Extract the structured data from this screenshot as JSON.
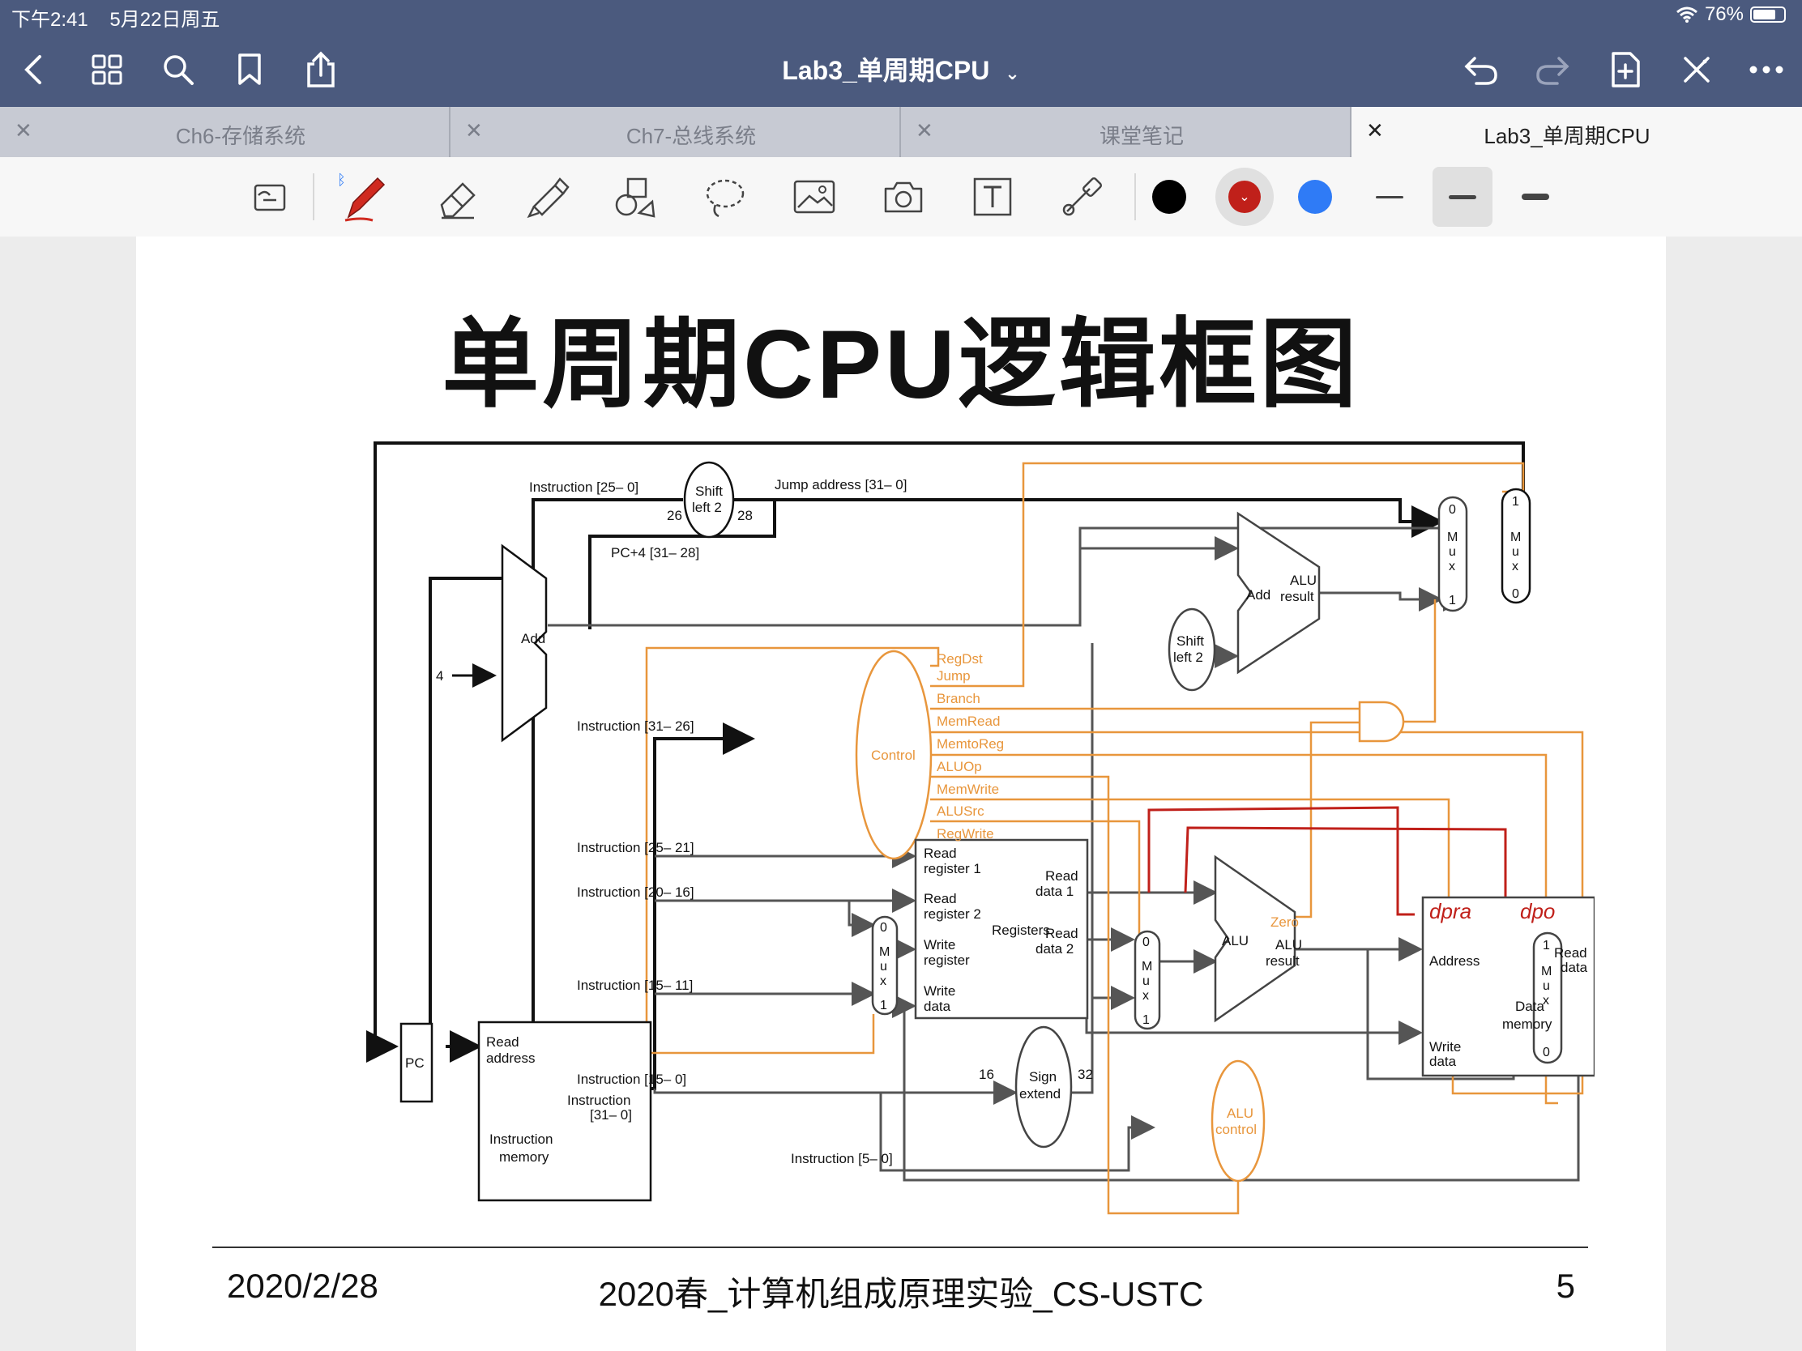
{
  "status": {
    "time": "下午2:41",
    "date": "5月22日周五",
    "battery": "76%",
    "battery_level": 0.76
  },
  "navbar": {
    "title": "Lab3_单周期CPU",
    "icons": [
      "back-icon",
      "grid-icon",
      "search-icon",
      "bookmark-icon",
      "share-icon",
      "undo-icon",
      "redo-icon",
      "add-page-icon",
      "close-tools-icon",
      "more-icon"
    ]
  },
  "tabs": [
    {
      "label": "Ch6-存储系统",
      "active": false
    },
    {
      "label": "Ch7-总线系统",
      "active": false
    },
    {
      "label": "课堂笔记",
      "active": false
    },
    {
      "label": "Lab3_单周期CPU",
      "active": true
    }
  ],
  "toolbar": {
    "tools": [
      "read-mode-icon",
      "pen-icon",
      "eraser-icon",
      "highlighter-icon",
      "shapes-icon",
      "lasso-icon",
      "image-icon",
      "camera-icon",
      "text-icon",
      "elements-icon"
    ],
    "colors": [
      "#000000",
      "#c0201a",
      "#2f7bf6"
    ],
    "selected_color": "#c0201a",
    "stroke_widths": [
      "thin",
      "medium",
      "thick"
    ],
    "selected_stroke": "medium"
  },
  "slide": {
    "title": "单周期CPU逻辑框图",
    "footer_date": "2020/2/28",
    "footer_course": "2020春_计算机组成原理实验_CS-USTC",
    "footer_page": "5"
  },
  "diagram": {
    "labels": {
      "instr_25_0": "Instruction [25– 0]",
      "shift_left_2": "Shift",
      "shift_left_2b": "left 2",
      "n26": "26",
      "n28": "28",
      "jump_address": "Jump address [31– 0]",
      "pc4": "PC+4 [31– 28]",
      "add": "Add",
      "four": "4",
      "alu_result_add": "ALU",
      "alu_result_add2": "result",
      "control": "Control",
      "instr_31_26": "Instruction [31– 26]",
      "regdst": "RegDst",
      "jump": "Jump",
      "branch": "Branch",
      "memread": "MemRead",
      "memtoreg": "MemtoReg",
      "aluop": "ALUOp",
      "memwrite": "MemWrite",
      "alusrc": "ALUSrc",
      "regwrite": "RegWrite",
      "pc": "PC",
      "read_address": "Read",
      "read_address2": "address",
      "instruction": "Instruction",
      "instruction_31_0": "[31– 0]",
      "instruction_memory": "Instruction",
      "instruction_memory2": "memory",
      "instr_25_21": "Instruction [25– 21]",
      "instr_20_16": "Instruction [20– 16]",
      "instr_15_11": "Instruction [15– 11]",
      "instr_15_0": "Instruction [15– 0]",
      "instr_5_0": "Instruction [5– 0]",
      "read_register_1": "Read",
      "read_register_1b": "register 1",
      "read_register_2": "Read",
      "read_register_2b": "register 2",
      "write_register": "Write",
      "write_register2": "register",
      "write_data": "Write",
      "write_data2": "data",
      "registers": "Registers",
      "read_data_1": "Read",
      "read_data_1b": "data 1",
      "read_data_2": "Read",
      "read_data_2b": "data 2",
      "sign_extend": "Sign",
      "sign_extend2": "extend",
      "n16": "16",
      "n32": "32",
      "alu": "ALU",
      "zero": "Zero",
      "alu_result": "ALU",
      "alu_result2": "result",
      "alu_control": "ALU",
      "alu_control2": "control",
      "address": "Address",
      "read_data": "Read",
      "read_data2": "data",
      "data_memory": "Data",
      "data_memory2": "memory",
      "mem_write_data": "Write",
      "mem_write_data2": "data",
      "mux_m": "M",
      "mux_u": "u",
      "mux_x": "x",
      "mux_0": "0",
      "mux_1": "1"
    },
    "annotations": {
      "dpra": "dpra",
      "dpo": "dpo"
    },
    "colors": {
      "control": "#e8963c",
      "datapath": "#555555",
      "bold": "#111111",
      "annotation": "#c0201a"
    }
  }
}
